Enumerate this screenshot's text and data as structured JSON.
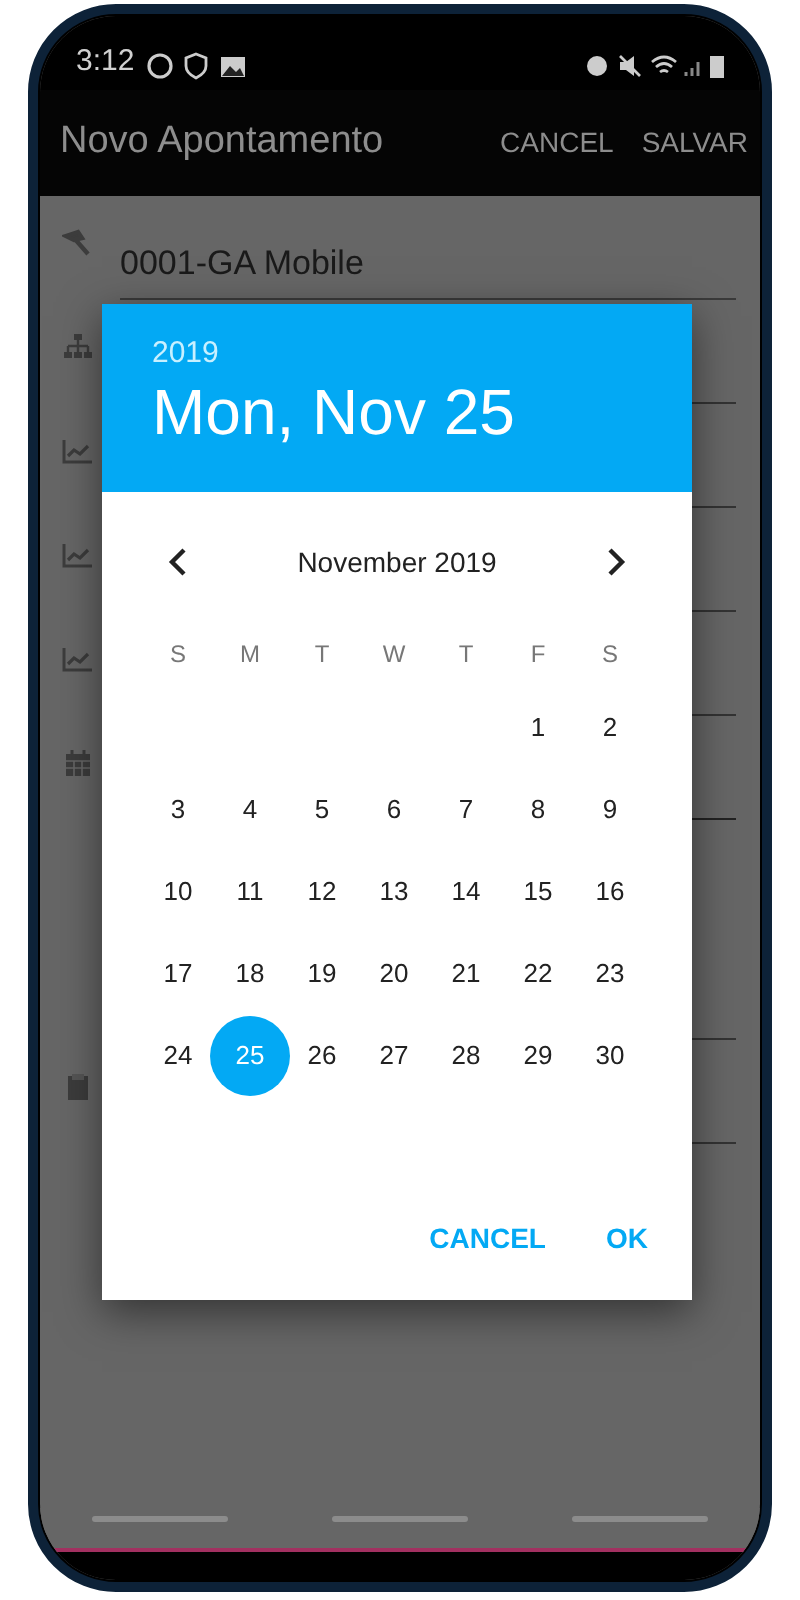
{
  "status_bar": {
    "time": "3:12"
  },
  "app_bar": {
    "title": "Novo Apontamento",
    "actions": [
      "CANCEL",
      "SALVAR"
    ]
  },
  "form": {
    "project_value": "0001-GA Mobile"
  },
  "date_picker": {
    "year": "2019",
    "date": "Mon, Nov 25",
    "month": "November 2019",
    "weekdays": [
      "S",
      "M",
      "T",
      "W",
      "T",
      "F",
      "S"
    ],
    "weeks": [
      {
        "days": [
          {
            "label": "1",
            "selected": false
          },
          {
            "label": "2",
            "selected": false
          }
        ]
      },
      {
        "days": [
          {
            "label": "3",
            "selected": false
          },
          {
            "label": "4",
            "selected": false
          },
          {
            "label": "5",
            "selected": false
          },
          {
            "label": "6",
            "selected": false
          },
          {
            "label": "7",
            "selected": false
          },
          {
            "label": "8",
            "selected": false
          },
          {
            "label": "9",
            "selected": false
          }
        ]
      },
      {
        "days": [
          {
            "label": "10",
            "selected": false
          },
          {
            "label": "11",
            "selected": false
          },
          {
            "label": "12",
            "selected": false
          },
          {
            "label": "13",
            "selected": false
          },
          {
            "label": "14",
            "selected": false
          },
          {
            "label": "15",
            "selected": false
          },
          {
            "label": "16",
            "selected": false
          }
        ]
      },
      {
        "days": [
          {
            "label": "17",
            "selected": false
          },
          {
            "label": "18",
            "selected": false
          },
          {
            "label": "19",
            "selected": false
          },
          {
            "label": "20",
            "selected": false
          },
          {
            "label": "21",
            "selected": false
          },
          {
            "label": "22",
            "selected": false
          },
          {
            "label": "23",
            "selected": false
          }
        ]
      },
      {
        "days": [
          {
            "label": "24",
            "selected": false
          },
          {
            "label": "25",
            "selected": true
          },
          {
            "label": "26",
            "selected": false
          },
          {
            "label": "27",
            "selected": false
          },
          {
            "label": "28",
            "selected": false
          },
          {
            "label": "29",
            "selected": false
          },
          {
            "label": "30",
            "selected": false
          }
        ]
      }
    ],
    "buttons": [
      "CANCEL",
      "OK"
    ]
  }
}
